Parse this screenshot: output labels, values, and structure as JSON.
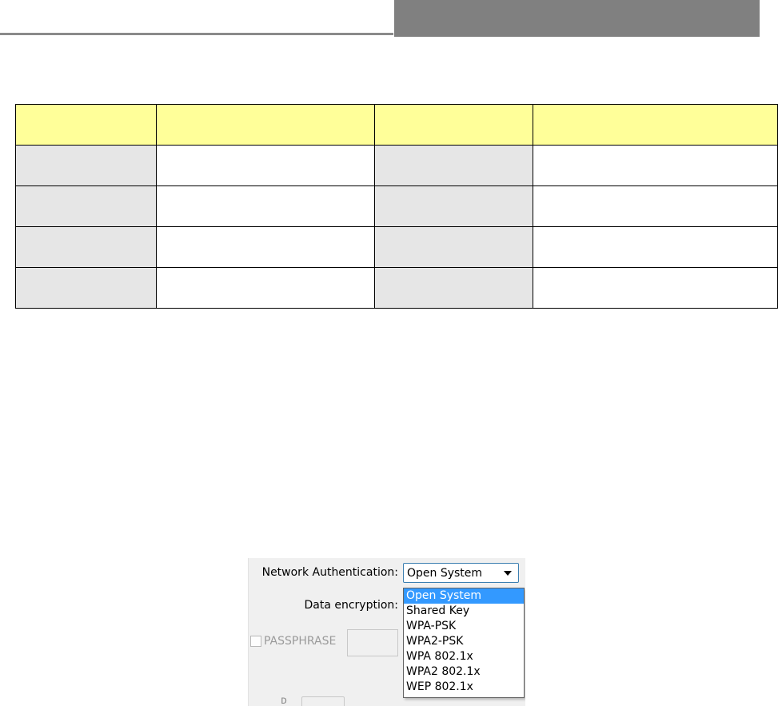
{
  "header": {},
  "table": {
    "rows": [
      [
        "",
        "",
        "",
        ""
      ],
      [
        "",
        "",
        "",
        ""
      ],
      [
        "",
        "",
        "",
        ""
      ],
      [
        "",
        "",
        "",
        ""
      ],
      [
        "",
        "",
        "",
        ""
      ]
    ]
  },
  "dialog": {
    "auth_label": "Network Authentication:",
    "auth_value": "Open System",
    "encryption_label": "Data encryption:",
    "passphrase_label": "PASSPHRASE",
    "auth_options": [
      "Open System",
      "Shared Key",
      "WPA-PSK",
      "WPA2-PSK",
      "WPA 802.1x",
      "WPA2 802.1x",
      "WEP 802.1x"
    ],
    "selected_option": "Open System",
    "colors": {
      "highlight": "#3399ff",
      "table_header": "#ffff99",
      "table_shade": "#e6e6e6"
    }
  }
}
